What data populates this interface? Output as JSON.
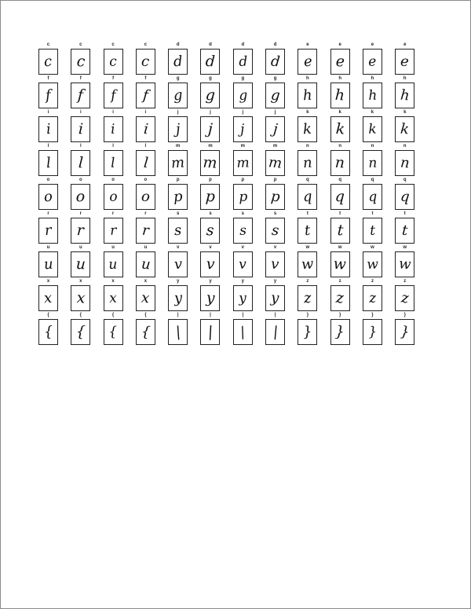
{
  "sheet": {
    "columns": 12,
    "rows": [
      {
        "label": "c",
        "glyph": "c"
      },
      {
        "label": "c",
        "glyph": "c"
      },
      {
        "label": "c",
        "glyph": "c"
      },
      {
        "label": "c",
        "glyph": "c"
      },
      {
        "label": "d",
        "glyph": "d"
      },
      {
        "label": "d",
        "glyph": "d"
      },
      {
        "label": "d",
        "glyph": "d"
      },
      {
        "label": "d",
        "glyph": "d"
      },
      {
        "label": "e",
        "glyph": "e"
      },
      {
        "label": "e",
        "glyph": "e"
      },
      {
        "label": "e",
        "glyph": "e"
      },
      {
        "label": "e",
        "glyph": "e"
      },
      {
        "label": "f",
        "glyph": "f"
      },
      {
        "label": "f",
        "glyph": "f"
      },
      {
        "label": "f",
        "glyph": "f"
      },
      {
        "label": "f",
        "glyph": "f"
      },
      {
        "label": "g",
        "glyph": "g"
      },
      {
        "label": "g",
        "glyph": "g"
      },
      {
        "label": "g",
        "glyph": "g"
      },
      {
        "label": "g",
        "glyph": "g"
      },
      {
        "label": "h",
        "glyph": "h"
      },
      {
        "label": "h",
        "glyph": "h"
      },
      {
        "label": "h",
        "glyph": "h"
      },
      {
        "label": "h",
        "glyph": "h"
      },
      {
        "label": "i",
        "glyph": "i"
      },
      {
        "label": "i",
        "glyph": "i"
      },
      {
        "label": "i",
        "glyph": "i"
      },
      {
        "label": "i",
        "glyph": "i"
      },
      {
        "label": "j",
        "glyph": "j"
      },
      {
        "label": "j",
        "glyph": "j"
      },
      {
        "label": "j",
        "glyph": "j"
      },
      {
        "label": "j",
        "glyph": "j"
      },
      {
        "label": "k",
        "glyph": "k"
      },
      {
        "label": "k",
        "glyph": "k"
      },
      {
        "label": "k",
        "glyph": "k"
      },
      {
        "label": "k",
        "glyph": "k"
      },
      {
        "label": "l",
        "glyph": "l"
      },
      {
        "label": "l",
        "glyph": "l"
      },
      {
        "label": "l",
        "glyph": "l"
      },
      {
        "label": "l",
        "glyph": "l"
      },
      {
        "label": "m",
        "glyph": "m"
      },
      {
        "label": "m",
        "glyph": "m"
      },
      {
        "label": "m",
        "glyph": "m"
      },
      {
        "label": "m",
        "glyph": "m"
      },
      {
        "label": "n",
        "glyph": "n"
      },
      {
        "label": "n",
        "glyph": "n"
      },
      {
        "label": "n",
        "glyph": "n"
      },
      {
        "label": "n",
        "glyph": "n"
      },
      {
        "label": "o",
        "glyph": "o"
      },
      {
        "label": "o",
        "glyph": "o"
      },
      {
        "label": "o",
        "glyph": "o"
      },
      {
        "label": "o",
        "glyph": "o"
      },
      {
        "label": "p",
        "glyph": "p"
      },
      {
        "label": "p",
        "glyph": "p"
      },
      {
        "label": "p",
        "glyph": "p"
      },
      {
        "label": "p",
        "glyph": "p"
      },
      {
        "label": "q",
        "glyph": "q"
      },
      {
        "label": "q",
        "glyph": "q"
      },
      {
        "label": "q",
        "glyph": "q"
      },
      {
        "label": "q",
        "glyph": "q"
      },
      {
        "label": "r",
        "glyph": "r"
      },
      {
        "label": "r",
        "glyph": "r"
      },
      {
        "label": "r",
        "glyph": "r"
      },
      {
        "label": "r",
        "glyph": "r"
      },
      {
        "label": "s",
        "glyph": "s"
      },
      {
        "label": "s",
        "glyph": "s"
      },
      {
        "label": "s",
        "glyph": "s"
      },
      {
        "label": "s",
        "glyph": "s"
      },
      {
        "label": "t",
        "glyph": "t"
      },
      {
        "label": "t",
        "glyph": "t"
      },
      {
        "label": "t",
        "glyph": "t"
      },
      {
        "label": "t",
        "glyph": "t"
      },
      {
        "label": "u",
        "glyph": "u"
      },
      {
        "label": "u",
        "glyph": "u"
      },
      {
        "label": "u",
        "glyph": "u"
      },
      {
        "label": "u",
        "glyph": "u"
      },
      {
        "label": "v",
        "glyph": "v"
      },
      {
        "label": "v",
        "glyph": "v"
      },
      {
        "label": "v",
        "glyph": "v"
      },
      {
        "label": "v",
        "glyph": "v"
      },
      {
        "label": "w",
        "glyph": "w"
      },
      {
        "label": "w",
        "glyph": "w"
      },
      {
        "label": "w",
        "glyph": "w"
      },
      {
        "label": "w",
        "glyph": "w"
      },
      {
        "label": "x",
        "glyph": "x"
      },
      {
        "label": "x",
        "glyph": "x"
      },
      {
        "label": "x",
        "glyph": "x"
      },
      {
        "label": "x",
        "glyph": "x"
      },
      {
        "label": "y",
        "glyph": "y"
      },
      {
        "label": "y",
        "glyph": "y"
      },
      {
        "label": "y",
        "glyph": "y"
      },
      {
        "label": "y",
        "glyph": "y"
      },
      {
        "label": "z",
        "glyph": "z"
      },
      {
        "label": "z",
        "glyph": "z"
      },
      {
        "label": "z",
        "glyph": "z"
      },
      {
        "label": "z",
        "glyph": "z"
      },
      {
        "label": "{",
        "glyph": "{"
      },
      {
        "label": "{",
        "glyph": "{"
      },
      {
        "label": "{",
        "glyph": "{"
      },
      {
        "label": "{",
        "glyph": "{"
      },
      {
        "label": "|",
        "glyph": "|"
      },
      {
        "label": "|",
        "glyph": "|"
      },
      {
        "label": "|",
        "glyph": "|"
      },
      {
        "label": "|",
        "glyph": "|"
      },
      {
        "label": "}",
        "glyph": "}"
      },
      {
        "label": "}",
        "glyph": "}"
      },
      {
        "label": "}",
        "glyph": "}"
      },
      {
        "label": "}",
        "glyph": "}"
      }
    ]
  }
}
